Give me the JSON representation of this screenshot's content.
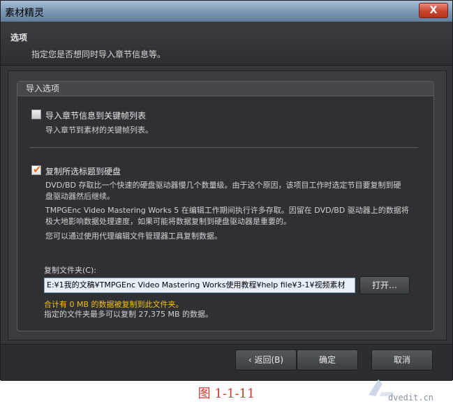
{
  "window": {
    "title": "素材精灵",
    "close_glyph": "X"
  },
  "header": {
    "title": "选项",
    "description": "指定您是否想同时导入章节信息等。"
  },
  "group": {
    "title": "导入选项"
  },
  "options": {
    "chapter": {
      "label": "导入章节信息到关键帧列表",
      "checked": false,
      "description": "导入章节到素材的关键帧列表。"
    },
    "copy": {
      "label": "复制所选标题到硬盘",
      "checked": true,
      "check_glyph": "✔",
      "description1": "DVD/BD 存取比一个快速的硬盘驱动器慢几个数量级。由于这个原因，该项目工作时选定节目要复制到硬盘驱动器然后继续。",
      "description2": "TMPGEnc Video Mastering Works 5 在编辑工作期间执行许多存取。因留在 DVD/BD 驱动器上的数据将极大地影响数据处理速度，如果可能将数据复制到硬盘驱动器是重要的。",
      "description3": "您可以通过使用代理编辑文件管理器工具复制数据。"
    }
  },
  "folder": {
    "label": "复制文件夹(C):",
    "value": "E:¥1我的文稿¥TMPGEnc Video Mastering Works使用教程¥help file¥3-1¥视频素材",
    "open_button": "打开…",
    "warning": "合计有 0 MB 的数据被复制到此文件夹。",
    "info": "指定的文件夹最多可以复制 27,375 MB 的数据。"
  },
  "footer": {
    "back_button": "返回(B)",
    "back_icon": "chevron-left-icon",
    "ok_button": "确定",
    "cancel_button": "取消"
  },
  "caption": "图 1-1-11",
  "watermark_text": "dvedit.cn",
  "colors": {
    "accent_check": "#e8731e",
    "warning_text": "#f0c020",
    "caption_red": "#d23a32"
  }
}
